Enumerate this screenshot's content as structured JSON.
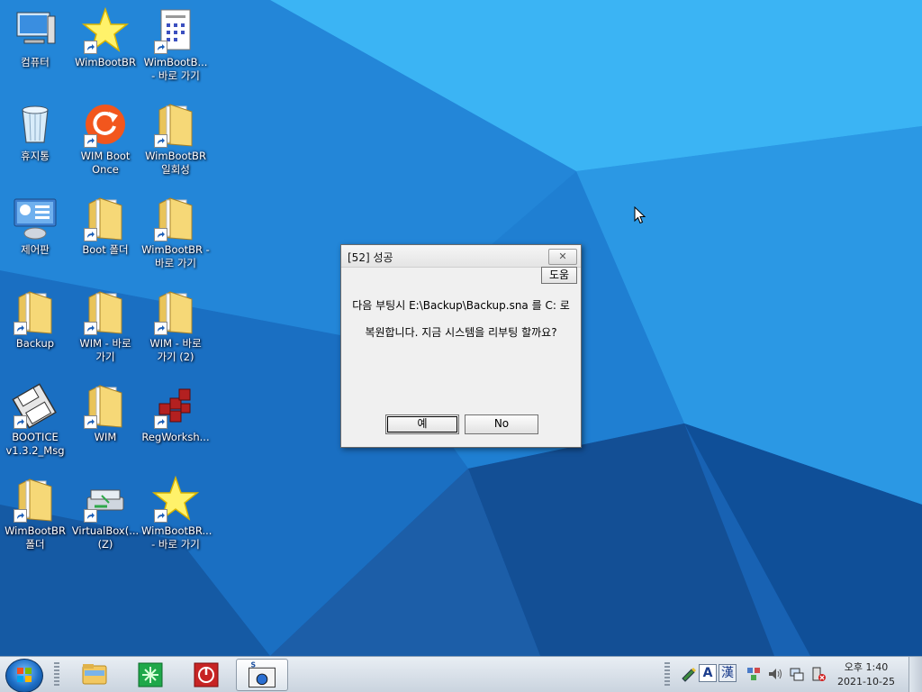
{
  "desktop": {
    "icons": [
      {
        "label": "컴퓨터",
        "icon": "computer-icon",
        "shortcut": false
      },
      {
        "label": "WimBootBR",
        "icon": "star-icon",
        "shortcut": true
      },
      {
        "label": "WimBootB...\n- 바로 가기",
        "icon": "document-icon",
        "shortcut": true
      },
      {
        "label": "휴지통",
        "icon": "recycle-bin-icon",
        "shortcut": false
      },
      {
        "label": "WIM Boot\nOnce",
        "icon": "refresh-icon",
        "shortcut": true
      },
      {
        "label": "WimBootBR\n일회성",
        "icon": "folder-icon",
        "shortcut": true
      },
      {
        "label": "제어판",
        "icon": "control-panel-icon",
        "shortcut": false
      },
      {
        "label": "Boot 폴더",
        "icon": "folder-icon",
        "shortcut": true
      },
      {
        "label": "WimBootBR -\n바로 가기",
        "icon": "folder-icon",
        "shortcut": true
      },
      {
        "label": "Backup",
        "icon": "folder-icon",
        "shortcut": true
      },
      {
        "label": "WIM - 바로\n가기",
        "icon": "folder-icon",
        "shortcut": true
      },
      {
        "label": "WIM - 바로\n가기 (2)",
        "icon": "folder-icon",
        "shortcut": true
      },
      {
        "label": "BOOTICE\nv1.3.2_Msg",
        "icon": "floppy-icon",
        "shortcut": true
      },
      {
        "label": "WIM",
        "icon": "folder-icon",
        "shortcut": true
      },
      {
        "label": "RegWorksh...",
        "icon": "registry-cubes-icon",
        "shortcut": true
      },
      {
        "label": "WimBootBR\n폴더",
        "icon": "folder-icon",
        "shortcut": true
      },
      {
        "label": "VirtualBox(...\n(Z)",
        "icon": "drive-icon",
        "shortcut": true
      },
      {
        "label": "WimBootBR...\n- 바로 가기",
        "icon": "star-icon",
        "shortcut": true
      }
    ]
  },
  "dialog": {
    "title": "[52] 성공",
    "close_label": "✕",
    "help_label": "도움",
    "message_line1": "다음 부팅시 E:\\Backup\\Backup.sna 를 C: 로",
    "message_line2": "복원합니다. 지금 시스템을 리부팅 할까요?",
    "yes_label": "예",
    "no_label": "No"
  },
  "taskbar": {
    "start_icon": "windows-orb-icon",
    "items": [
      "file-explorer-icon",
      "green-app-icon",
      "red-power-icon",
      "snapshot-app-icon"
    ],
    "tray_icons": [
      "pen-icon",
      "ime-a-icon",
      "ime-hanja-icon",
      "network-cubes-icon",
      "volume-icon",
      "network-icon",
      "power-icon"
    ],
    "ime_a": "A",
    "ime_hanja": "漢",
    "clock_time": "오후 1:40",
    "clock_date": "2021-10-25"
  }
}
